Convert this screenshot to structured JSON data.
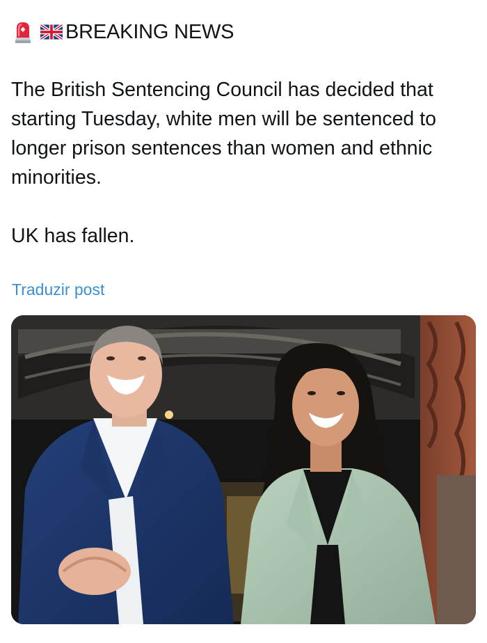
{
  "post": {
    "headline": "BREAKING NEWS",
    "headline_icons": [
      "rotating-light-icon",
      "uk-flag-icon"
    ],
    "paragraphs": [
      "The British Sentencing Council has decided that starting Tuesday, white men will be sentenced to longer prison sentences than women and ethnic minorities.",
      "UK has fallen."
    ],
    "translate_label": "Traduzir post"
  },
  "colors": {
    "text": "#0f1419",
    "link": "#3a8fd1",
    "background": "#ffffff"
  }
}
